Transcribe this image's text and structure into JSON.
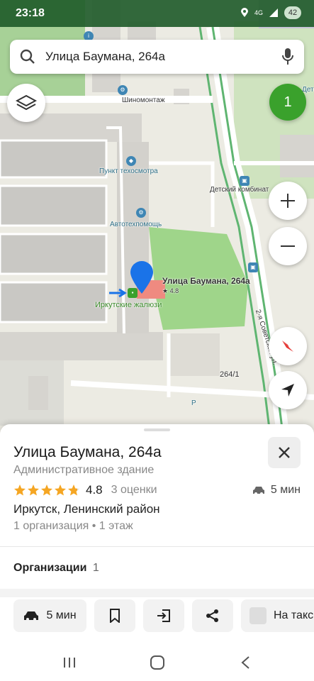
{
  "status_bar": {
    "time": "23:18",
    "network": "4G",
    "battery": "42"
  },
  "search": {
    "query": "Улица Баумана, 264а"
  },
  "map": {
    "user_badge": "1",
    "labels": {
      "tire": "Шиномонтаж",
      "inspection": "Пункт техосмотра",
      "autohelp": "Автотехпомощь",
      "kindergarten": "Детский комбинат",
      "blinds": "Иркутские жалюзи",
      "building": "264/1",
      "street": "2-я Советская ул.",
      "marker_title": "Улица Баумана, 264а",
      "marker_rating": "★ 4.8",
      "parking": "P",
      "corner_label": "Детс"
    }
  },
  "place": {
    "title": "Улица Баумана, 264а",
    "type": "Административное здание",
    "rating": "4.8",
    "rating_fraction": 0.96,
    "rating_count": "3 оценки",
    "drive_time": "5 мин",
    "address": "Иркутск, Ленинский район",
    "org_info": "1 организация • 1 этаж",
    "orgs_label": "Организации",
    "orgs_count": "1"
  },
  "actions": {
    "route_time": "5 мин",
    "taxi_label": "На такс"
  },
  "colors": {
    "accent_green": "#3aa12c",
    "marker_blue": "#1a73e8",
    "star": "#f5a623"
  }
}
